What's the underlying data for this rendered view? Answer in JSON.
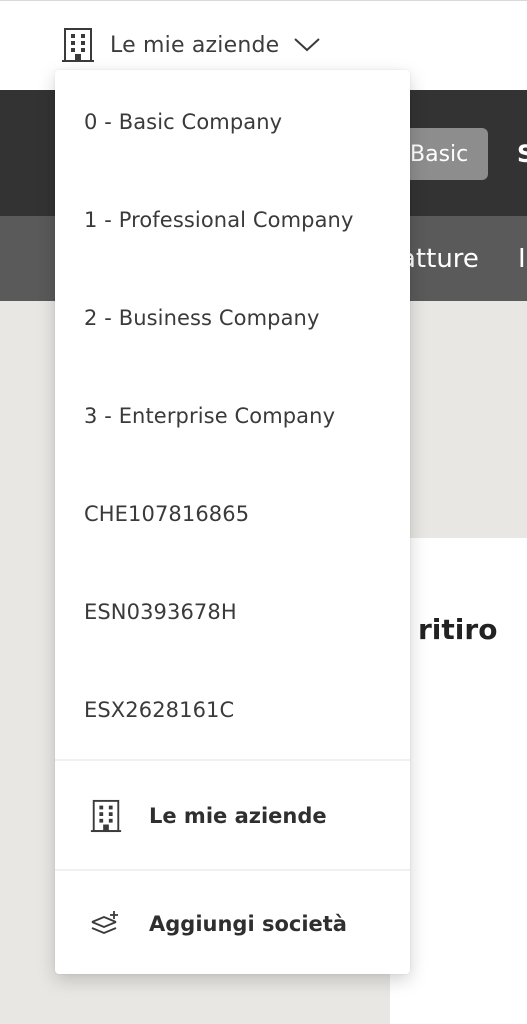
{
  "header": {
    "company_selector_label": "Le mie aziende",
    "plan_badge": "Basic",
    "right_glyph": "S"
  },
  "nav": {
    "partial_item": "atture",
    "partial_item_2": "I"
  },
  "content": {
    "card_title_partial": "ritiro"
  },
  "dropdown": {
    "companies": [
      {
        "label": "0 - Basic Company"
      },
      {
        "label": "1 - Professional Company"
      },
      {
        "label": "2 - Business Company"
      },
      {
        "label": "3 - Enterprise Company"
      },
      {
        "label": "CHE107816865"
      },
      {
        "label": "ESN0393678H"
      },
      {
        "label": "ESX2628161C"
      }
    ],
    "actions": {
      "my_companies": {
        "label": "Le mie aziende",
        "icon": "building-icon"
      },
      "add_company": {
        "label": "Aggiungi società",
        "icon": "add-layers-icon"
      }
    }
  },
  "colors": {
    "dark_header": "#333333",
    "nav_bar": "#5a5a5a",
    "badge": "#8d8d8d",
    "background": "#e8e7e3"
  }
}
